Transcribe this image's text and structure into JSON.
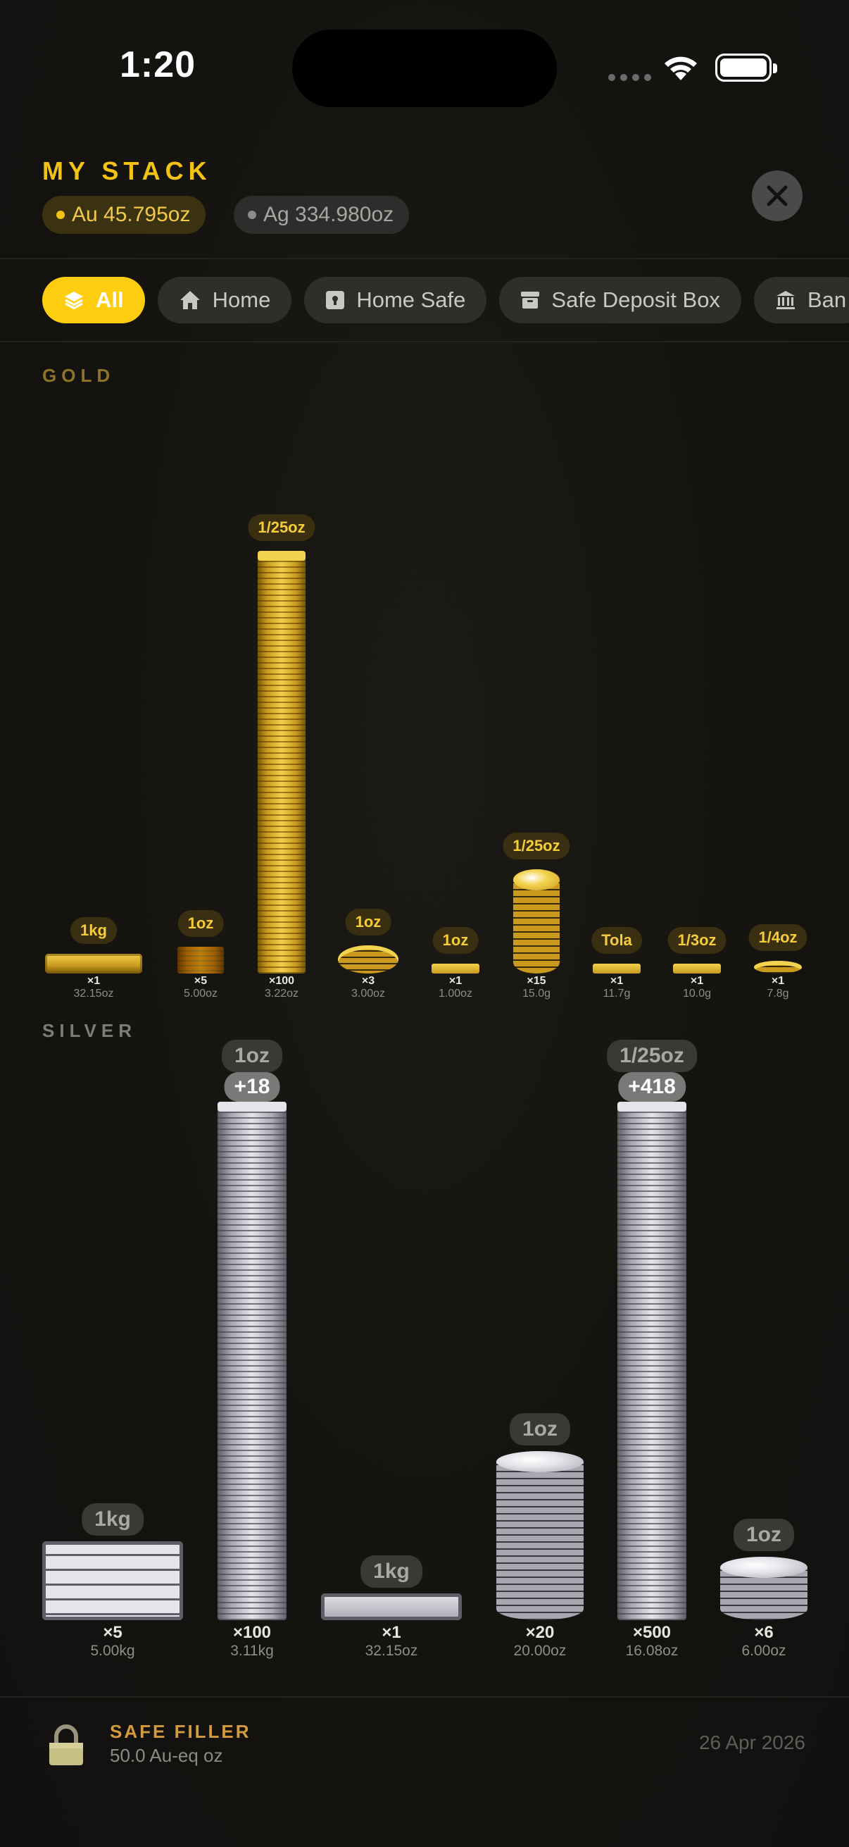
{
  "status_bar": {
    "time": "1:20"
  },
  "header": {
    "title": "MY STACK",
    "gold_pill": "Au 45.795oz",
    "silver_pill": "Ag 334.980oz"
  },
  "tabs": [
    {
      "label": "All",
      "icon": "layers-icon",
      "active": true
    },
    {
      "label": "Home",
      "icon": "house-icon",
      "active": false
    },
    {
      "label": "Home Safe",
      "icon": "safe-icon",
      "active": false
    },
    {
      "label": "Safe Deposit Box",
      "icon": "archive-box-icon",
      "active": false
    },
    {
      "label": "Ban",
      "icon": "bank-icon",
      "active": false
    }
  ],
  "sections": {
    "gold": "GOLD",
    "silver": "SILVER"
  },
  "gold_items": [
    {
      "label": "1kg",
      "count": "×1",
      "weight": "32.15oz",
      "kind": "bar",
      "value": 1
    },
    {
      "label": "1oz",
      "count": "×5",
      "weight": "5.00oz",
      "kind": "smallbar",
      "value": 5
    },
    {
      "label": "1/25oz",
      "count": "×100",
      "weight": "3.22oz",
      "kind": "tallbar",
      "value": 100
    },
    {
      "label": "1oz",
      "count": "×3",
      "weight": "3.00oz",
      "kind": "coin",
      "value": 3
    },
    {
      "label": "1oz",
      "count": "×1",
      "weight": "1.00oz",
      "kind": "thinbar",
      "value": 1
    },
    {
      "label": "1/25oz",
      "count": "×15",
      "weight": "15.0g",
      "kind": "coinstack",
      "value": 15
    },
    {
      "label": "Tola",
      "count": "×1",
      "weight": "11.7g",
      "kind": "thinbar",
      "value": 1
    },
    {
      "label": "1/3oz",
      "count": "×1",
      "weight": "10.0g",
      "kind": "thinbar",
      "value": 1
    },
    {
      "label": "1/4oz",
      "count": "×1",
      "weight": "7.8g",
      "kind": "coin",
      "value": 1
    }
  ],
  "silver_items": [
    {
      "label": "1kg",
      "count": "×5",
      "weight": "5.00kg",
      "kind": "bigbar",
      "value": 5
    },
    {
      "label": "1oz",
      "overflow": "+18",
      "count": "×100",
      "weight": "3.11kg",
      "kind": "tallbar",
      "value": 100
    },
    {
      "label": "1kg",
      "count": "×1",
      "weight": "32.15oz",
      "kind": "bigbar",
      "value": 1
    },
    {
      "label": "1oz",
      "count": "×20",
      "weight": "20.00oz",
      "kind": "coinstack",
      "value": 20
    },
    {
      "label": "1/25oz",
      "overflow": "+418",
      "count": "×500",
      "weight": "16.08oz",
      "kind": "tallbar",
      "value": 500
    },
    {
      "label": "1oz",
      "count": "×6",
      "weight": "6.00oz",
      "kind": "coinstack",
      "value": 6
    }
  ],
  "footer": {
    "title": "SAFE FILLER",
    "subtitle": "50.0 Au-eq oz",
    "date": "26 Apr 2026"
  },
  "colors": {
    "accent": "#ffcd10",
    "gold_text": "#f2c215",
    "silver_text": "#a9a8a5",
    "background": "#15130f"
  }
}
